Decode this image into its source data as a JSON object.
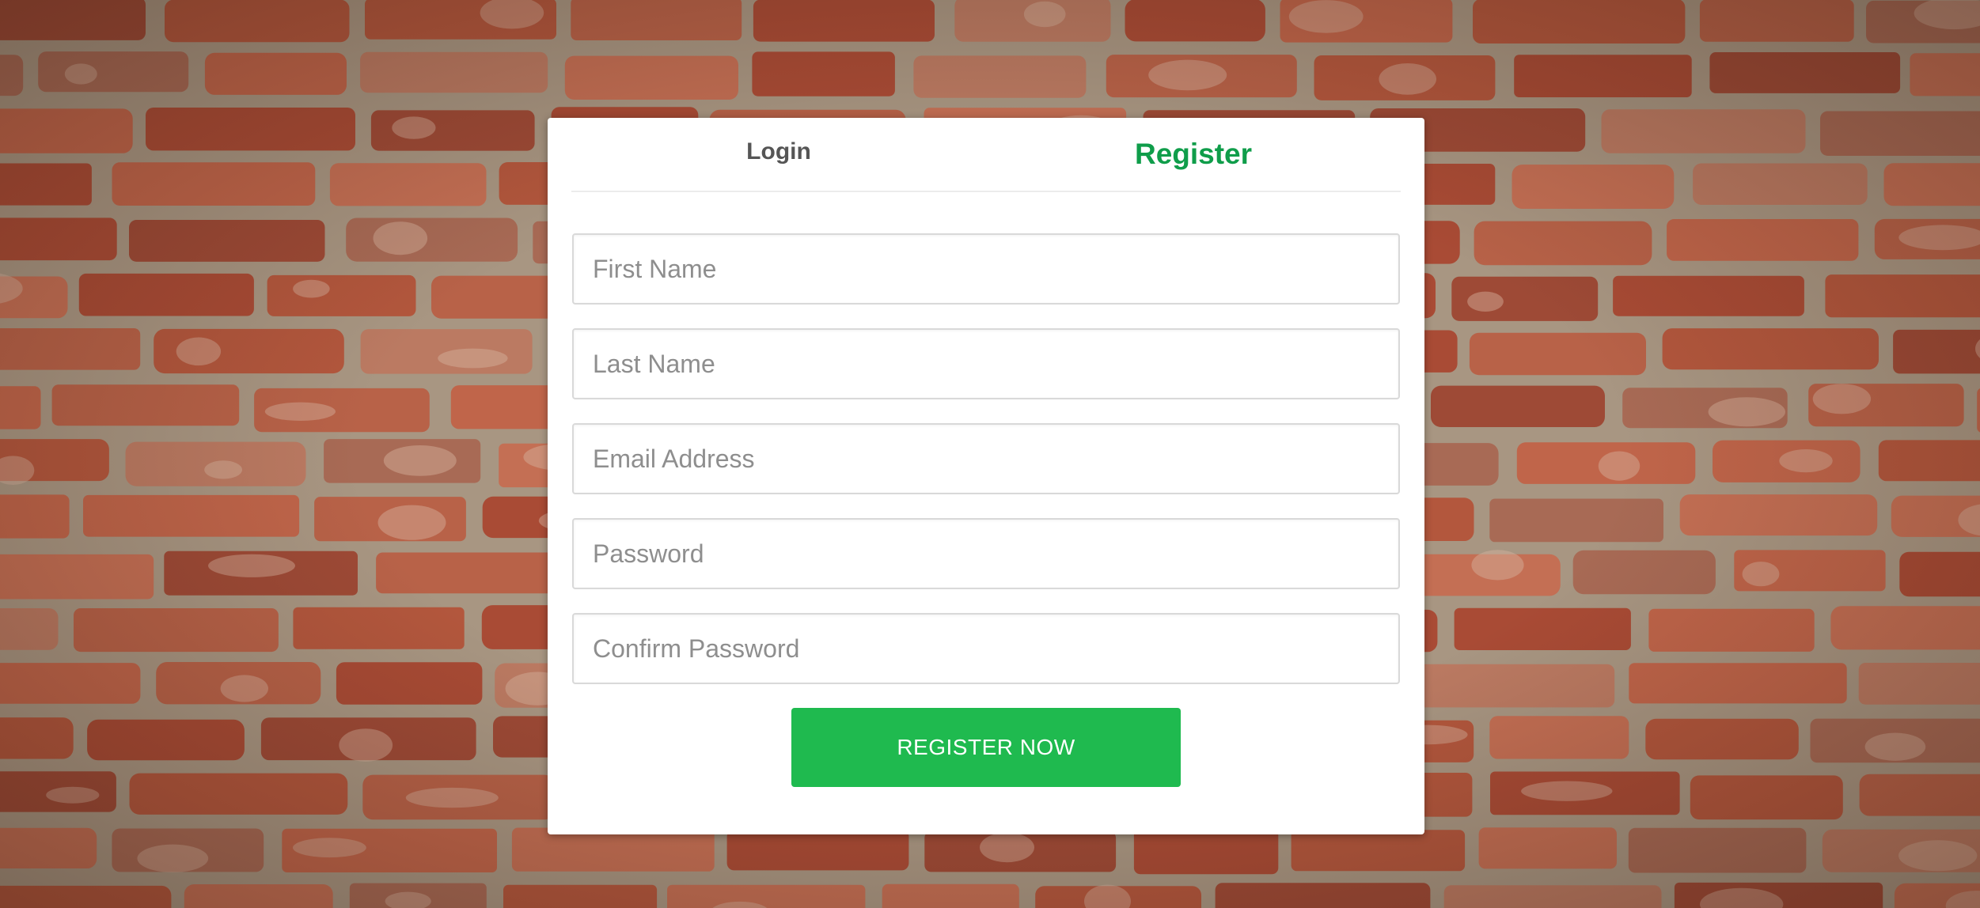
{
  "tabs": {
    "login_label": "Login",
    "register_label": "Register",
    "active": "register"
  },
  "form": {
    "first_name_placeholder": "First Name",
    "last_name_placeholder": "Last Name",
    "email_placeholder": "Email Address",
    "password_placeholder": "Password",
    "confirm_password_placeholder": "Confirm Password",
    "first_name_value": "",
    "last_name_value": "",
    "email_value": "",
    "password_value": "",
    "confirm_password_value": "",
    "submit_label": "REGISTER NOW"
  },
  "colors": {
    "accent": "#1fba4f",
    "active_tab": "#0f9d4a",
    "inactive_tab": "#555555"
  },
  "background": {
    "description_icon": "brick-wall-texture"
  }
}
